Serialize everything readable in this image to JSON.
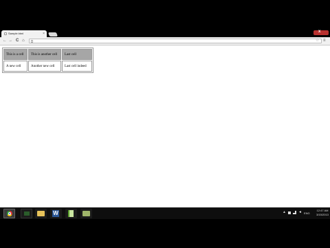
{
  "browser": {
    "tab_title": "Sample.html",
    "tab_close": "×",
    "nav": {
      "back": "←",
      "forward": "→",
      "reload": "C",
      "home": "⌂"
    },
    "address": "",
    "star": "☆",
    "menu": "≡",
    "window_close": "x"
  },
  "table": {
    "rows": [
      [
        "This is a cell",
        "This is another cell",
        "Last cell"
      ],
      [
        "A new cell",
        "Another new cell",
        "Last cell indeed"
      ]
    ],
    "header_bg": "#a6a6a6"
  },
  "taskbar": {
    "apps": [
      "chrome-icon",
      "command-prompt-icon",
      "file-explorer-icon",
      "word-icon",
      "notepad-icon",
      "app-icon"
    ],
    "tray": {
      "arrow": "▲",
      "volume": "◄",
      "language": "ENG",
      "time": "12:47 AM",
      "date": "3/15/2013"
    }
  }
}
